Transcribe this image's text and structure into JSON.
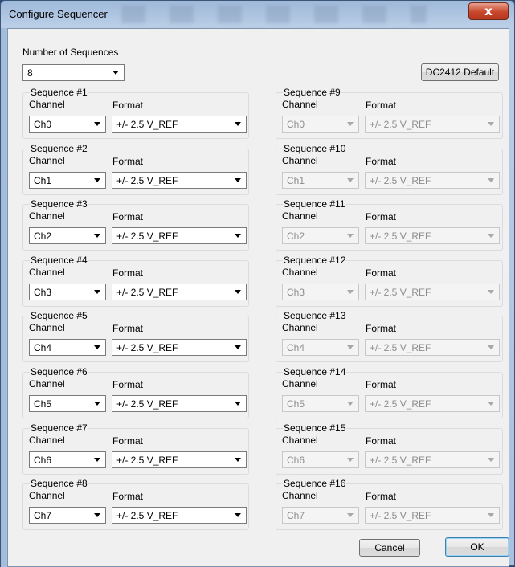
{
  "window": {
    "title": "Configure Sequencer",
    "close_glyph": "x"
  },
  "top": {
    "num_sequences_label": "Number of Sequences",
    "num_sequences_value": "8",
    "default_button": "DC2412 Default"
  },
  "labels": {
    "channel": "Channel",
    "format": "Format"
  },
  "sequences": [
    {
      "title": "Sequence #1",
      "channel": "Ch0",
      "format": "+/- 2.5 V_REF",
      "enabled": true
    },
    {
      "title": "Sequence #2",
      "channel": "Ch1",
      "format": "+/- 2.5 V_REF",
      "enabled": true
    },
    {
      "title": "Sequence #3",
      "channel": "Ch2",
      "format": "+/- 2.5 V_REF",
      "enabled": true
    },
    {
      "title": "Sequence #4",
      "channel": "Ch3",
      "format": "+/- 2.5 V_REF",
      "enabled": true
    },
    {
      "title": "Sequence #5",
      "channel": "Ch4",
      "format": "+/- 2.5 V_REF",
      "enabled": true
    },
    {
      "title": "Sequence #6",
      "channel": "Ch5",
      "format": "+/- 2.5 V_REF",
      "enabled": true
    },
    {
      "title": "Sequence #7",
      "channel": "Ch6",
      "format": "+/- 2.5 V_REF",
      "enabled": true
    },
    {
      "title": "Sequence #8",
      "channel": "Ch7",
      "format": "+/- 2.5 V_REF",
      "enabled": true
    },
    {
      "title": "Sequence #9",
      "channel": "Ch0",
      "format": "+/- 2.5 V_REF",
      "enabled": false
    },
    {
      "title": "Sequence #10",
      "channel": "Ch1",
      "format": "+/- 2.5 V_REF",
      "enabled": false
    },
    {
      "title": "Sequence #11",
      "channel": "Ch2",
      "format": "+/- 2.5 V_REF",
      "enabled": false
    },
    {
      "title": "Sequence #12",
      "channel": "Ch3",
      "format": "+/- 2.5 V_REF",
      "enabled": false
    },
    {
      "title": "Sequence #13",
      "channel": "Ch4",
      "format": "+/- 2.5 V_REF",
      "enabled": false
    },
    {
      "title": "Sequence #14",
      "channel": "Ch5",
      "format": "+/- 2.5 V_REF",
      "enabled": false
    },
    {
      "title": "Sequence #15",
      "channel": "Ch6",
      "format": "+/- 2.5 V_REF",
      "enabled": false
    },
    {
      "title": "Sequence #16",
      "channel": "Ch7",
      "format": "+/- 2.5 V_REF",
      "enabled": false
    }
  ],
  "buttons": {
    "cancel": "Cancel",
    "ok": "OK"
  }
}
